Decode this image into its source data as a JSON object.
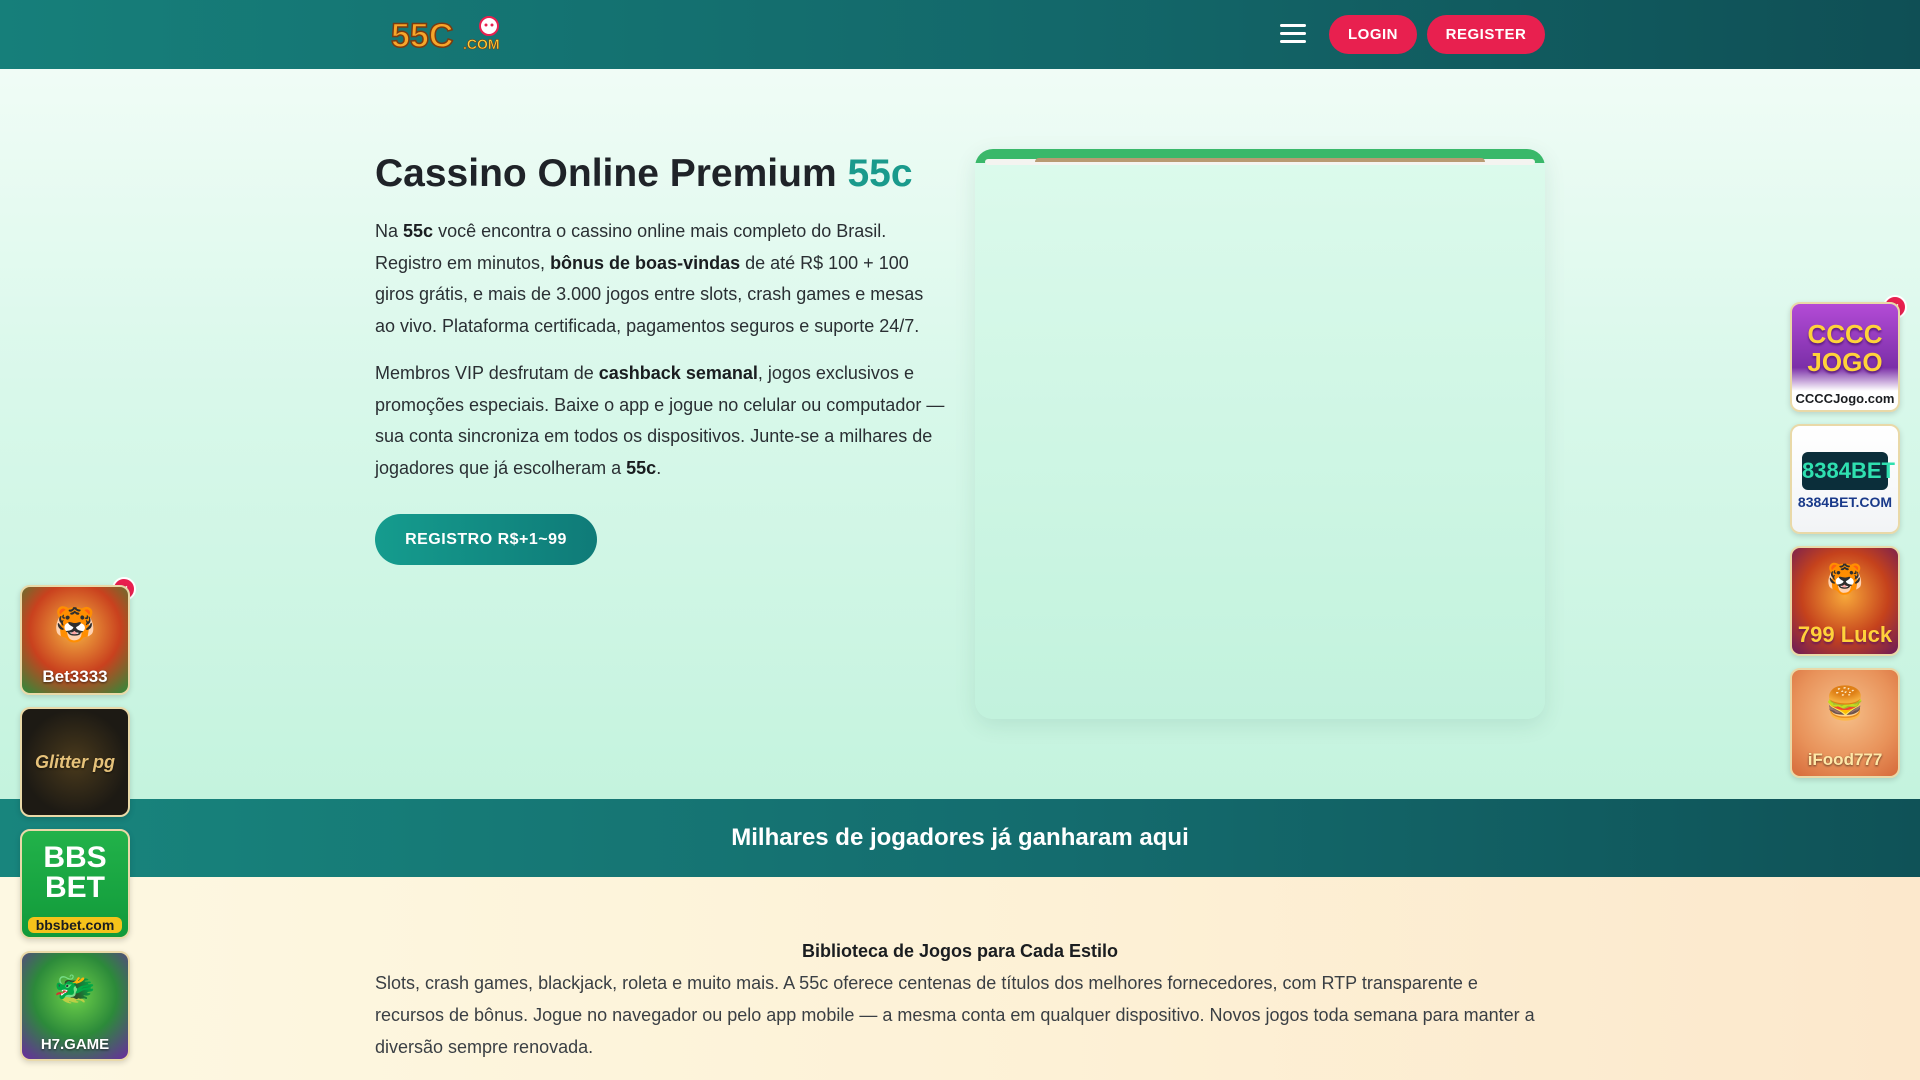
{
  "header": {
    "logo_text": "55C.COM",
    "login_label": "LOGIN",
    "register_label": "REGISTER"
  },
  "hero": {
    "title_main": "Cassino Online Premium",
    "title_accent": "55c",
    "p1": {
      "t1": "Na ",
      "b1": "55c",
      "t2": " você encontra o cassino online mais completo do Brasil. Registro em minutos, ",
      "b2": "bônus de boas-vindas",
      "t3": " de até R$ 100 + 100 giros grátis, e mais de 3.000 jogos entre slots, crash games e mesas ao vivo. Plataforma certificada, pagamentos seguros e suporte 24/7."
    },
    "p2": {
      "t1": "Membros VIP desfrutam de ",
      "b1": "cashback semanal",
      "t2": ", jogos exclusivos e promoções especiais. Baixe o app e jogue no celular ou computador — sua conta sincroniza em todos os dispositivos. Junte-se a milhares de jogadores que já escolheram a ",
      "b2": "55c",
      "t3": "."
    },
    "cta_label": "REGISTRO R$+1~99"
  },
  "band": {
    "text": "Milhares de jogadores já ganharam aqui"
  },
  "library": {
    "title": "Biblioteca de Jogos para Cada Estilo",
    "text": "Slots, crash games, blackjack, roleta e muito mais. A 55c oferece centenas de títulos dos melhores fornecedores, com RTP transparente e recursos de bônus. Jogue no navegador ou pelo app mobile — a mesma conta em qualquer dispositivo. Novos jogos toda semana para manter a diversão sempre renovada."
  },
  "side_apps": {
    "close_symbol": "×",
    "left": [
      {
        "label": "Bet3333"
      },
      {
        "label": "Glitter pg"
      },
      {
        "label": "bbsbet.com",
        "big": "BBS BET"
      },
      {
        "label": "H7.GAME"
      }
    ],
    "right": [
      {
        "label": "CCCCJogo.com",
        "big": "CCCC JOGO"
      },
      {
        "label": "8384BET.COM",
        "big": "8384BET"
      },
      {
        "label": "799 Luck"
      },
      {
        "label": "iFood777"
      }
    ]
  },
  "colors": {
    "header_bg": "#167f7a",
    "accent_pink": "#e8204f",
    "accent_teal": "#1a9a8c"
  }
}
